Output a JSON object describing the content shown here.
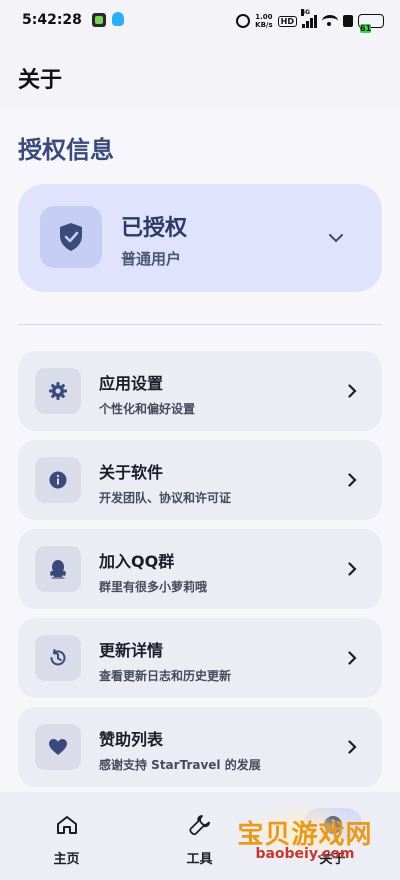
{
  "status_bar": {
    "time": "5:42:28",
    "net_speed_value": "1.00",
    "net_speed_unit": "KB/s",
    "hd_label": "HD",
    "network_type": "5G",
    "battery_level": "61",
    "battery_color": "#3bd34a",
    "icons": [
      "wechat-app-icon",
      "qq-app-icon",
      "alarm-icon",
      "signal-icon",
      "wifi-icon",
      "charging-icon",
      "battery-icon"
    ]
  },
  "app_bar": {
    "title": "关于"
  },
  "auth_section": {
    "title": "授权信息",
    "status": "已授权",
    "user_type": "普通用户",
    "icon": "shield-check-icon",
    "expand_icon": "chevron-down-icon"
  },
  "menu_items": [
    {
      "label": "应用设置",
      "description": "个性化和偏好设置",
      "icon": "gear-icon"
    },
    {
      "label": "关于软件",
      "description": "开发团队、协议和许可证",
      "icon": "info-icon"
    },
    {
      "label": "加入QQ群",
      "description": "群里有很多小萝莉哦",
      "icon": "qq-icon"
    },
    {
      "label": "更新详情",
      "description": "查看更新日志和历史更新",
      "icon": "history-icon"
    },
    {
      "label": "赞助列表",
      "description": "感谢支持 StarTravel 的发展",
      "icon": "heart-icon"
    }
  ],
  "bottom_nav": [
    {
      "label": "主页",
      "icon": "home-icon",
      "active": false
    },
    {
      "label": "工具",
      "icon": "wrench-icon",
      "active": false
    },
    {
      "label": "关于",
      "icon": "info-icon",
      "active": true
    }
  ],
  "watermark": {
    "text": "宝贝游戏网",
    "url": "baobeiy.com"
  },
  "colors": {
    "accent": "#3a4a7a",
    "card_bg": "#dfe3fb",
    "item_bg": "#ebecf4",
    "nav_active_pill": "#d6dbf8"
  }
}
